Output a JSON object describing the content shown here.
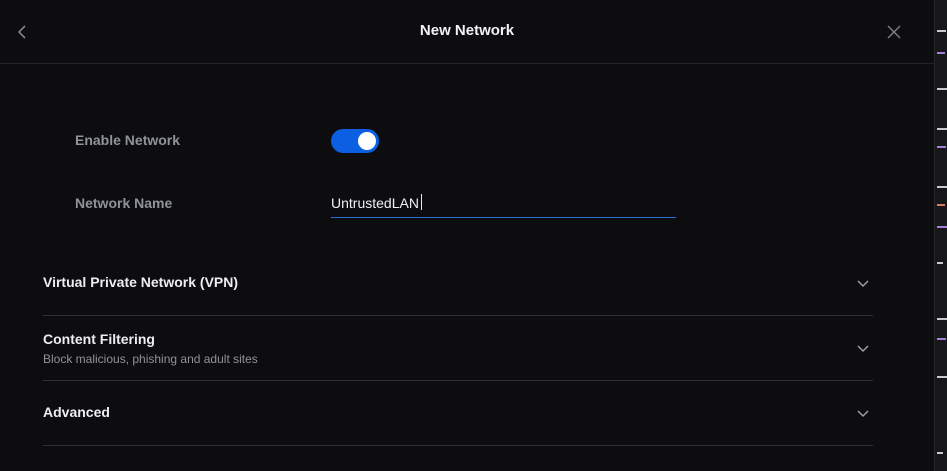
{
  "header": {
    "title": "New Network",
    "back_icon": "chevron-left-icon",
    "close_icon": "close-icon"
  },
  "form": {
    "enable_label": "Enable Network",
    "enable_value": true,
    "name_label": "Network Name",
    "name_value": "UntrustedLAN"
  },
  "sections": [
    {
      "title": "Virtual Private Network (VPN)",
      "subtitle": ""
    },
    {
      "title": "Content Filtering",
      "subtitle": "Block malicious, phishing and adult sites"
    },
    {
      "title": "Advanced",
      "subtitle": ""
    }
  ],
  "colors": {
    "accent": "#0b5fe0",
    "background": "#0d0d0f"
  }
}
